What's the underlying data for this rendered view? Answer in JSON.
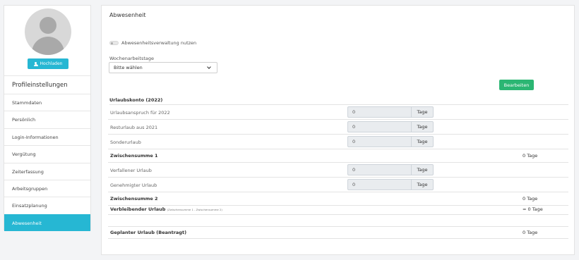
{
  "sidebar": {
    "upload_label": "Hochladen",
    "title": "Profileinstellungen",
    "items": [
      {
        "label": "Stammdaten",
        "active": false
      },
      {
        "label": "Persönlich",
        "active": false
      },
      {
        "label": "Login-Informationen",
        "active": false
      },
      {
        "label": "Vergütung",
        "active": false
      },
      {
        "label": "Zeiterfassung",
        "active": false
      },
      {
        "label": "Arbeitsgruppen",
        "active": false
      },
      {
        "label": "Einsatzplanung",
        "active": false
      },
      {
        "label": "Abwesenheit",
        "active": true
      }
    ]
  },
  "main": {
    "title": "Abwesenheit",
    "toggle_label": "Abwesenheitsverwaltung nutzen",
    "toggle_on": false,
    "workweek_label": "Wochenarbeitstage",
    "workweek_value": "Bitte wählen",
    "edit_label": "Bearbeiten",
    "section_title": "Urlaubskonto (2022)",
    "rows": [
      {
        "label": "Urlaubsanspruch für 2022",
        "value": "0",
        "unit": "Tage"
      },
      {
        "label": "Resturlaub aus 2021",
        "value": "0",
        "unit": "Tage"
      },
      {
        "label": "Sonderurlaub",
        "value": "0",
        "unit": "Tage"
      },
      {
        "label": "Zwischensumme 1",
        "total": "0 Tage"
      },
      {
        "label": "Verfallener Urlaub",
        "value": "0",
        "unit": "Tage"
      },
      {
        "label": "Genehmigter Urlaub",
        "value": "0",
        "unit": "Tage"
      },
      {
        "label": "Zwischensumme 2",
        "total": "0 Tage"
      },
      {
        "label": "Verbleibender Urlaub",
        "note": "(Zwischensumme 1 - Zwischensumme 2)",
        "total": "= 0 Tage"
      },
      {
        "label": "Geplanter Urlaub (Beantragt)",
        "total": "0 Tage"
      }
    ]
  }
}
